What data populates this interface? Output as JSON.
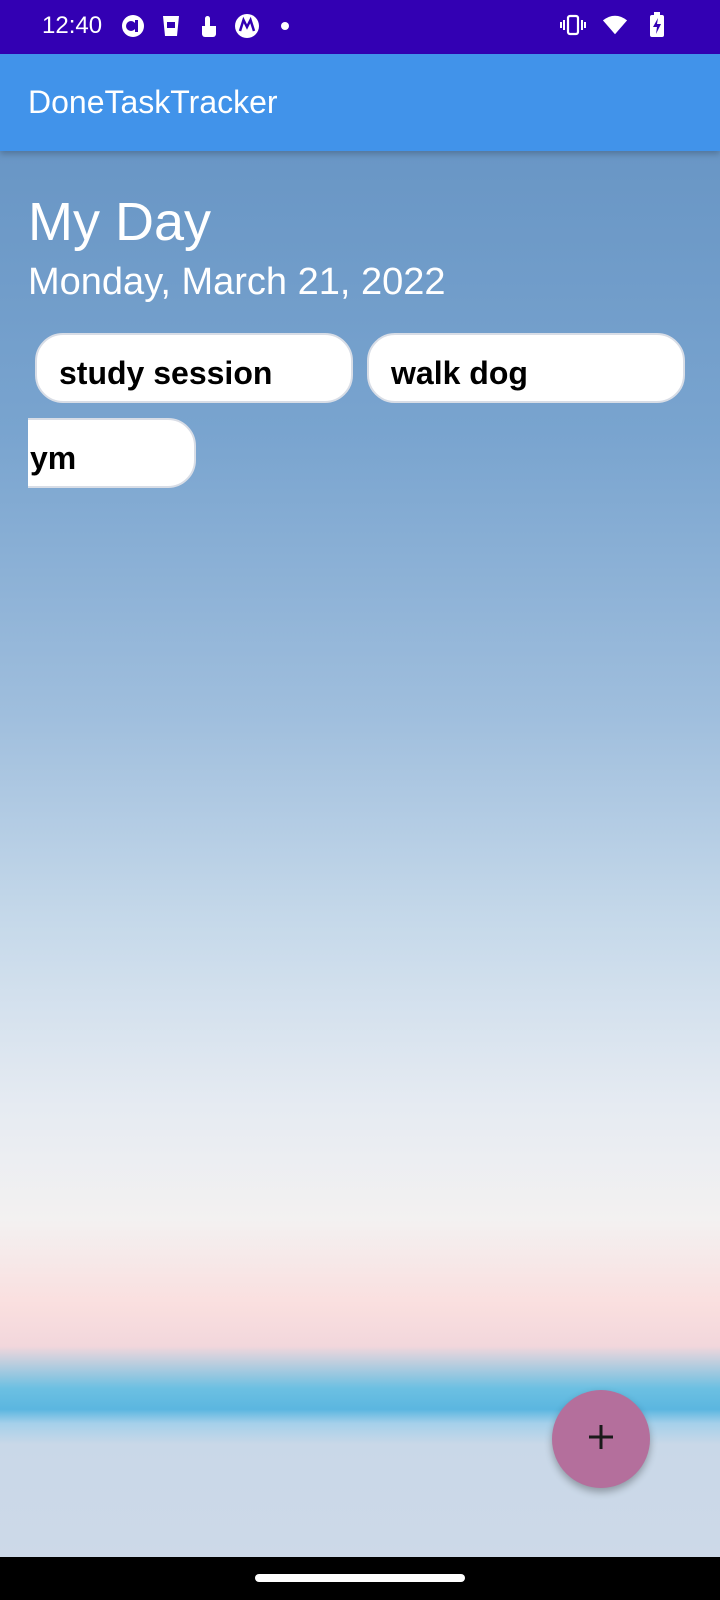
{
  "status_bar": {
    "time": "12:40",
    "left_icons": [
      "app-notification-icon",
      "cup-icon",
      "touch-icon",
      "motorola-icon",
      "dot-icon"
    ],
    "right_icons": [
      "vibrate-icon",
      "wifi-icon",
      "battery-charging-icon"
    ]
  },
  "app_bar": {
    "title": "DoneTaskTracker",
    "color": "#4193ea"
  },
  "main": {
    "heading": "My Day",
    "date": "Monday, March 21, 2022",
    "tasks": [
      {
        "label": "study session"
      },
      {
        "label": "walk dog"
      },
      {
        "label": "ym"
      }
    ]
  },
  "fab": {
    "icon": "plus-icon",
    "color": "#b46f9c"
  },
  "colors": {
    "status_bar": "#3300b3"
  }
}
